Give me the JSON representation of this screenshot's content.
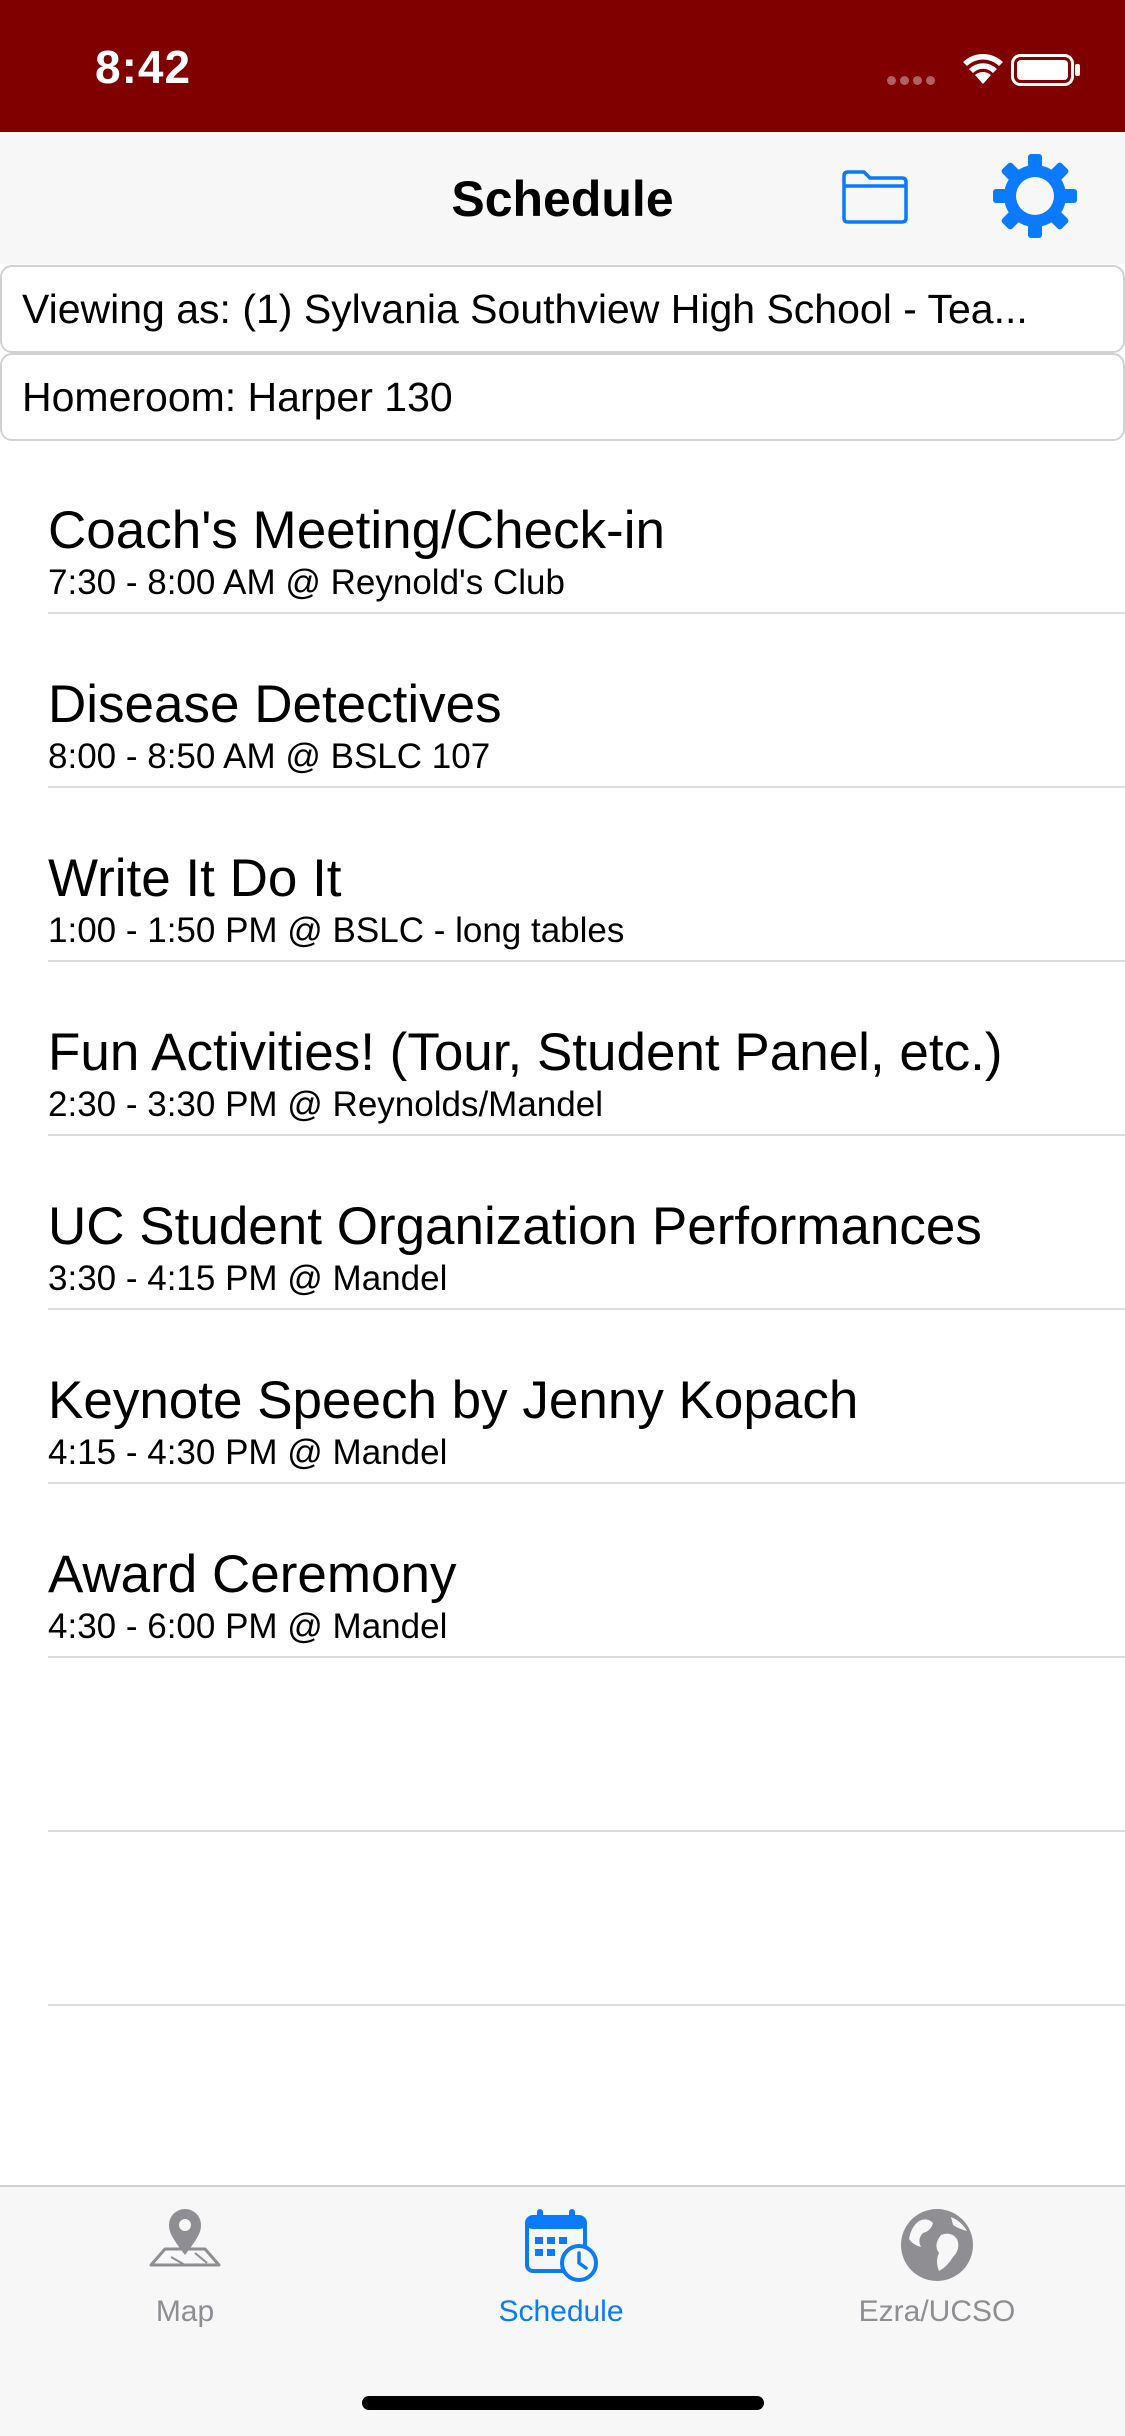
{
  "status_bar": {
    "time": "8:42",
    "bg_color": "#800000",
    "icons": [
      "signal-dots-icon",
      "wifi-icon",
      "battery-icon"
    ]
  },
  "nav_bar": {
    "title": "Schedule",
    "folder_icon": "folder-icon",
    "settings_icon": "gear-icon",
    "accent_color": "#0a7aff"
  },
  "info": {
    "viewing_as": "Viewing as: (1) Sylvania Southview High School - Tea...",
    "homeroom": "Homeroom: Harper 130"
  },
  "schedule": [
    {
      "title": "Coach's Meeting/Check-in",
      "detail": "7:30 - 8:00 AM @ Reynold's Club"
    },
    {
      "title": "Disease Detectives",
      "detail": "8:00 - 8:50 AM @ BSLC 107"
    },
    {
      "title": "Write It Do It",
      "detail": "1:00 - 1:50 PM @ BSLC - long tables"
    },
    {
      "title": "Fun Activities! (Tour, Student Panel, etc.)",
      "detail": "2:30 - 3:30 PM @ Reynolds/Mandel"
    },
    {
      "title": "UC Student Organization Performances",
      "detail": "3:30 - 4:15 PM @ Mandel"
    },
    {
      "title": "Keynote Speech by Jenny Kopach",
      "detail": "4:15 - 4:30 PM @ Mandel"
    },
    {
      "title": "Award Ceremony",
      "detail": "4:30 - 6:00 PM @ Mandel"
    },
    {
      "title": "",
      "detail": ""
    },
    {
      "title": "",
      "detail": ""
    }
  ],
  "tab_bar": {
    "tabs": [
      {
        "label": "Map",
        "icon": "map-pin-icon",
        "active": false
      },
      {
        "label": "Schedule",
        "icon": "calendar-clock-icon",
        "active": true
      },
      {
        "label": "Ezra/UCSO",
        "icon": "globe-icon",
        "active": false
      }
    ]
  }
}
